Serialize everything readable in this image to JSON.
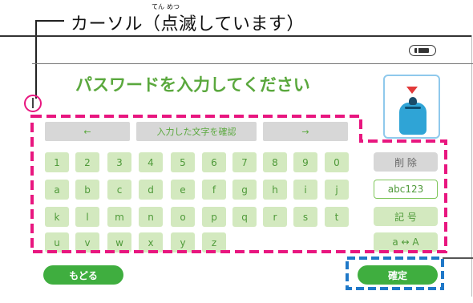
{
  "annotation": {
    "cursor_caption": "カーソル（点滅しています）",
    "ruby_ten": "てん",
    "ruby_metsu": "めつ"
  },
  "screen": {
    "prompt": "パスワードを入力してください",
    "cursor_char": "|"
  },
  "keyboard": {
    "left_arrow": "←",
    "confirm_input_label": "入力した文字を確認",
    "right_arrow": "→",
    "rows": [
      [
        "1",
        "2",
        "3",
        "4",
        "5",
        "6",
        "7",
        "8",
        "9",
        "0"
      ],
      [
        "a",
        "b",
        "c",
        "d",
        "e",
        "f",
        "g",
        "h",
        "i",
        "j"
      ],
      [
        "k",
        "l",
        "m",
        "n",
        "o",
        "p",
        "q",
        "r",
        "s",
        "t"
      ],
      [
        "u",
        "v",
        "w",
        "x",
        "y",
        "z"
      ]
    ],
    "side": {
      "delete": "削 除",
      "mode": "abc123",
      "symbols": "記 号",
      "case": "a ↔ A"
    }
  },
  "buttons": {
    "back": "もどる",
    "confirm": "確定"
  },
  "colors": {
    "highlight_magenta": "#e8167f",
    "highlight_blue": "#1f78c8",
    "key_green": "#d3e9bf",
    "button_green": "#3fae3f",
    "prompt_green": "#5aa83d"
  }
}
